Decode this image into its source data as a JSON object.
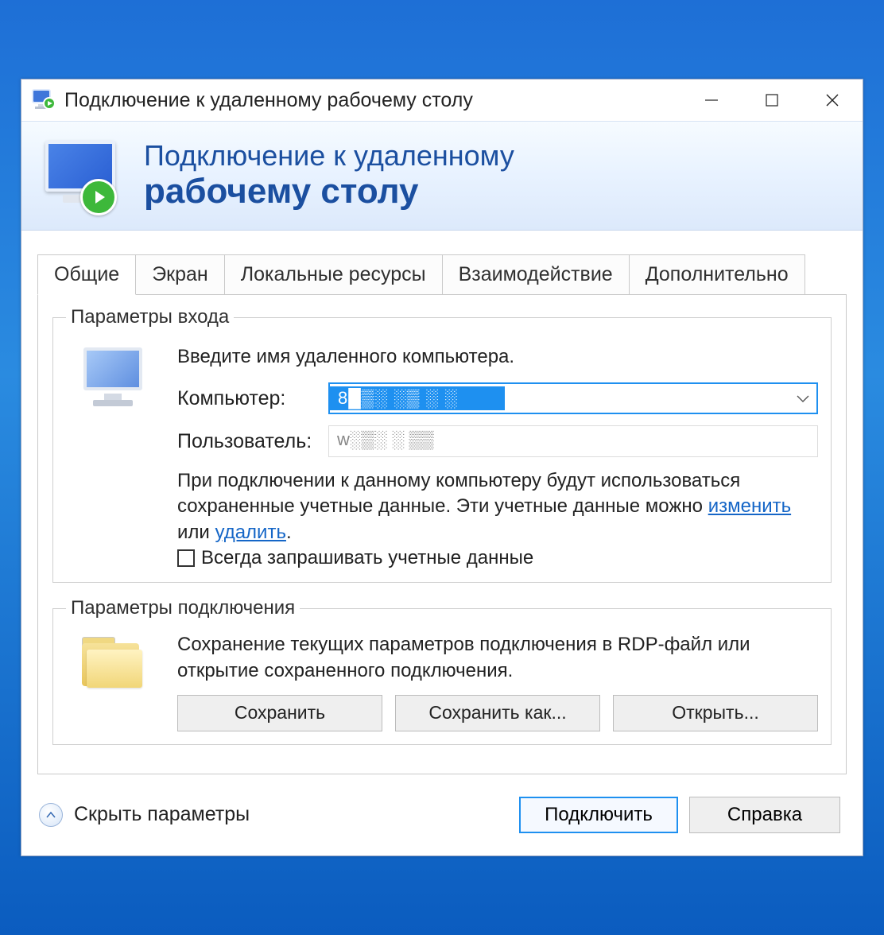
{
  "titlebar": {
    "title": "Подключение к удаленному рабочему столу"
  },
  "banner": {
    "line1": "Подключение к удаленному",
    "line2": "рабочему столу"
  },
  "tabs": [
    "Общие",
    "Экран",
    "Локальные ресурсы",
    "Взаимодействие",
    "Дополнительно"
  ],
  "login": {
    "legend": "Параметры входа",
    "prompt": "Введите имя удаленного компьютера.",
    "computer_label": "Компьютер:",
    "computer_value": "8█▒░   ░▒ ░   ░",
    "user_label": "Пользователь:",
    "user_value": "w░▒░  ░   ▒▒",
    "note_pre": "При подключении к данному компьютеру будут использоваться сохраненные учетные данные.  Эти учетные данные можно ",
    "link_edit": "изменить",
    "note_mid": " или ",
    "link_delete": "удалить",
    "note_post": ".",
    "always_ask": "Всегда запрашивать учетные данные"
  },
  "conn": {
    "legend": "Параметры подключения",
    "desc": "Сохранение текущих параметров подключения в RDP-файл или открытие сохраненного подключения.",
    "save": "Сохранить",
    "save_as": "Сохранить как...",
    "open": "Открыть..."
  },
  "footer": {
    "toggle": "Скрыть параметры",
    "connect": "Подключить",
    "help": "Справка"
  }
}
